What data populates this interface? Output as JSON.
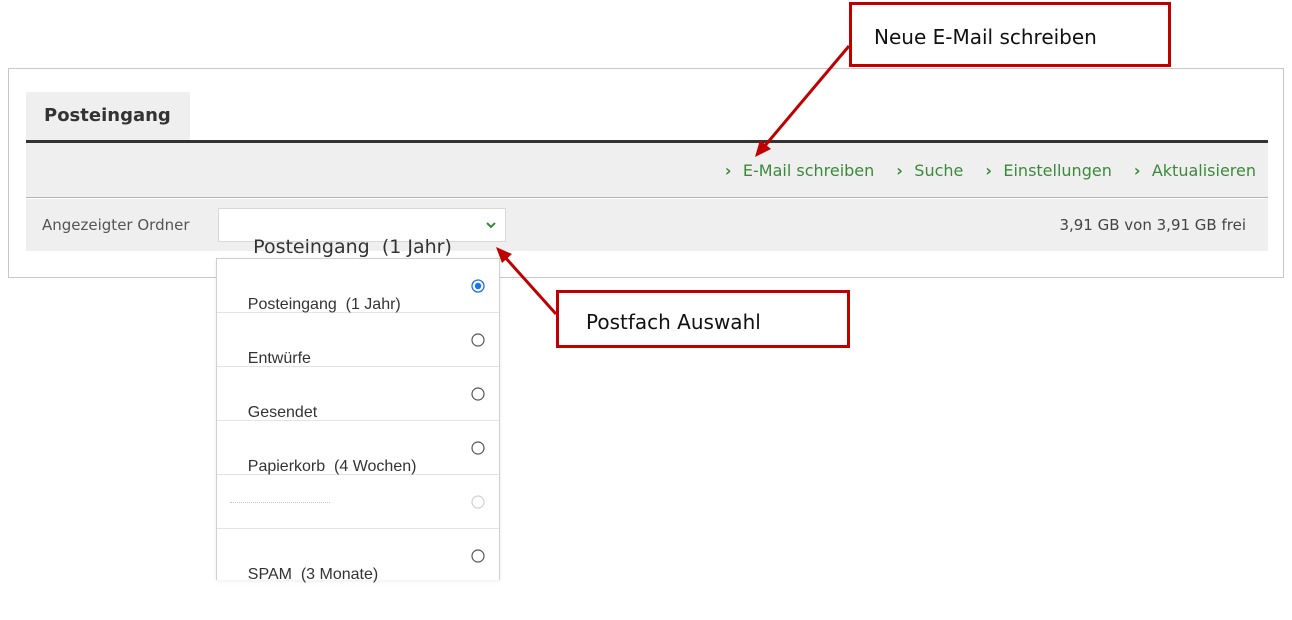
{
  "tab": {
    "label": "Posteingang"
  },
  "toolbar": {
    "links": [
      {
        "label": "E-Mail schreiben"
      },
      {
        "label": "Suche"
      },
      {
        "label": "Einstellungen"
      },
      {
        "label": "Aktualisieren"
      }
    ]
  },
  "folder": {
    "label": "Angezeigter Ordner",
    "selected": "Posteingang  (1 Jahr)",
    "quota": "3,91 GB von 3,91 GB frei"
  },
  "dropdown": {
    "options": [
      {
        "label": "Posteingang  (1 Jahr)",
        "selected": true
      },
      {
        "label": "Entwürfe",
        "selected": false
      },
      {
        "label": "Gesendet",
        "selected": false
      },
      {
        "label": "Papierkorb  (4 Wochen)",
        "selected": false
      },
      {
        "label": "",
        "selected": false,
        "separator": true
      },
      {
        "label": "SPAM  (3 Monate)",
        "selected": false
      }
    ]
  },
  "callouts": {
    "compose": "Neue E-Mail schreiben",
    "folder_select": "Postfach Auswahl"
  },
  "colors": {
    "link_green": "#3b8a3b",
    "annotation_red": "#c00000",
    "radio_selected": "#1a73e8",
    "bar_gray": "#efefef"
  },
  "icons": {
    "toolbar_link": "chevron-right-icon",
    "select": "chevron-down-icon",
    "option_selected": "radio-checked-icon",
    "option_unselected": "radio-unchecked-icon"
  }
}
